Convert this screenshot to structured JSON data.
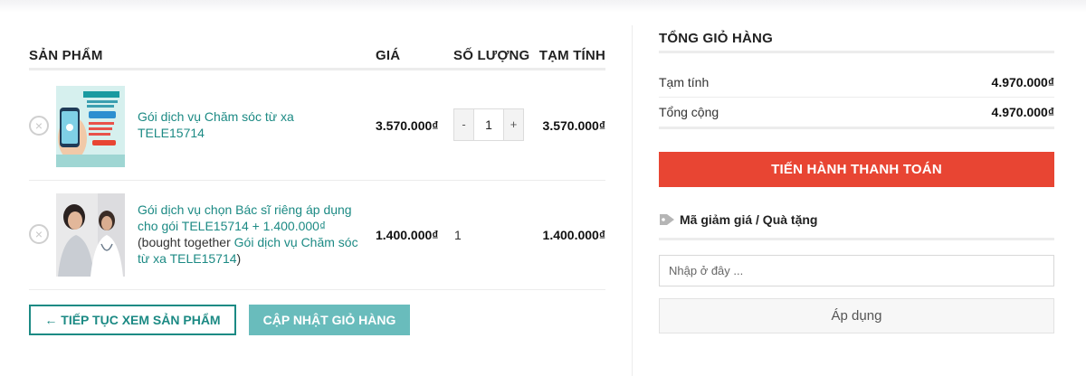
{
  "cart": {
    "headers": {
      "product": "SẢN PHẨM",
      "price": "GIÁ",
      "quantity": "SỐ LƯỢNG",
      "subtotal": "TẠM TÍNH"
    },
    "items": [
      {
        "remove_label": "×",
        "image_icon": "teledoctor-product-image",
        "name": "Gói dịch vụ Chăm sóc từ xa TELE15714",
        "price": "3.570.000₫",
        "quantity": "1",
        "qty_minus": "-",
        "qty_plus": "+",
        "subtotal": "3.570.000₫"
      },
      {
        "remove_label": "×",
        "image_icon": "doctor-patient-image",
        "name": "Gói dịch vụ chọn Bác sĩ riêng áp dụng cho gói TELE15714 + 1.400.000₫",
        "bought_together_prefix": "(bought together ",
        "bought_together_link": "Gói dịch vụ Chăm sóc từ xa TELE15714",
        "bought_together_suffix": ")",
        "price": "1.400.000₫",
        "quantity": "1",
        "subtotal": "1.400.000₫"
      }
    ],
    "actions": {
      "continue_label": "← TIẾP TỤC XEM SẢN PHẨM",
      "update_label": "CẬP NHẬT GIỎ HÀNG"
    }
  },
  "totals": {
    "title": "TỔNG GIỎ HÀNG",
    "subtotal_label": "Tạm tính",
    "subtotal_value": "4.970.000₫",
    "total_label": "Tổng cộng",
    "total_value": "4.970.000₫",
    "checkout_label": "TIẾN HÀNH THANH TOÁN"
  },
  "coupon": {
    "title": "Mã giảm giá / Quà tặng",
    "icon": "tag-icon",
    "placeholder": "Nhập ở đây ...",
    "apply_label": "Áp dụng"
  },
  "colors": {
    "link": "#1c8a84",
    "checkout": "#e84533",
    "update_button": "#69bcbc"
  }
}
